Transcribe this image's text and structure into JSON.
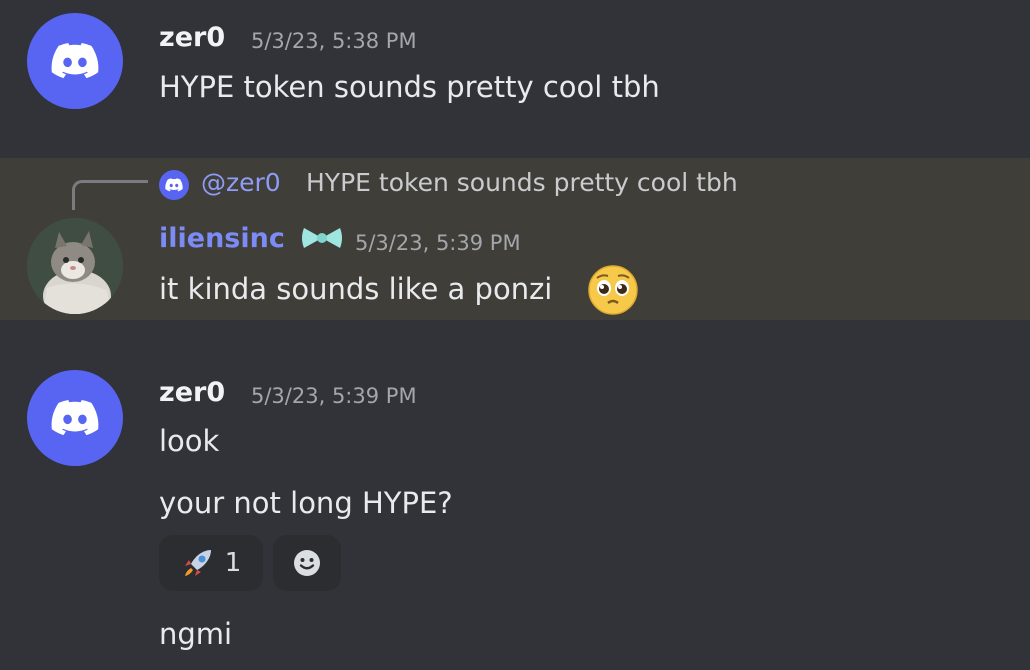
{
  "messages": [
    {
      "username": "zer0",
      "timestamp": "5/3/23, 5:38 PM",
      "avatar_icon": "discord-logo-icon",
      "lines": [
        "HYPE token sounds pretty cool tbh"
      ]
    },
    {
      "reply": {
        "mention": "@zer0",
        "text": "HYPE token sounds pretty cool tbh"
      },
      "username": "iliensinc",
      "timestamp": "5/3/23, 5:39 PM",
      "avatar_icon": "cat-avatar",
      "badge_icon": "bow-icon",
      "lines": [
        "it kinda sounds like a ponzi"
      ],
      "inline_emoji": "pleading-face-emoji"
    },
    {
      "username": "zer0",
      "timestamp": "5/3/23, 5:39 PM",
      "avatar_icon": "discord-logo-icon",
      "lines": [
        "look",
        "your not long HYPE?",
        "ngmi"
      ],
      "reactions": [
        {
          "emoji": "rocket-emoji",
          "count": "1"
        },
        {
          "emoji": "add-reaction-icon"
        }
      ]
    }
  ],
  "colors": {
    "background": "#313338",
    "highlight": "#403e38",
    "blurple": "#5865f2",
    "username_colored": "#7c8bf6",
    "timestamp": "#a3a6ab"
  }
}
